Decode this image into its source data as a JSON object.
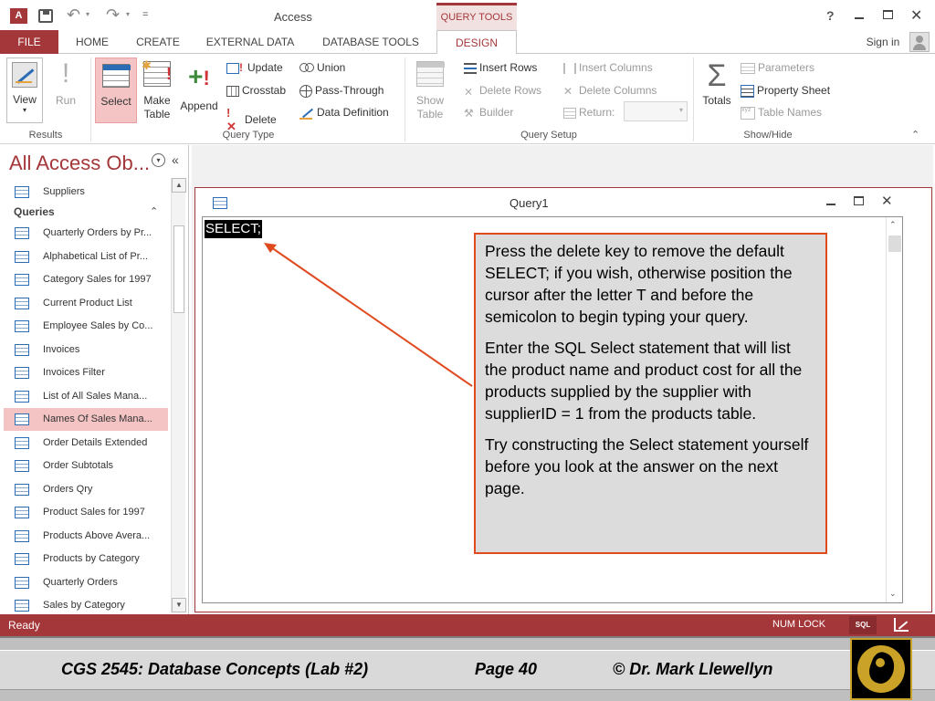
{
  "app": {
    "title": "Access",
    "help": "?",
    "context_tab_group": "QUERY TOOLS",
    "sign_in": "Sign in",
    "app_icon": "access-logo"
  },
  "quick_access": {
    "save_icon": "save-icon",
    "undo_icon": "undo-icon",
    "redo_icon": "redo-icon",
    "customize": "="
  },
  "tabs": [
    {
      "label": "FILE"
    },
    {
      "label": "HOME"
    },
    {
      "label": "CREATE"
    },
    {
      "label": "EXTERNAL DATA"
    },
    {
      "label": "DATABASE TOOLS"
    },
    {
      "label": "DESIGN"
    }
  ],
  "ribbon": {
    "results": {
      "view": "View",
      "run": "Run",
      "label": "Results"
    },
    "query_type": {
      "select": "Select",
      "make_table_1": "Make",
      "make_table_2": "Table",
      "append": "Append",
      "update": "Update",
      "crosstab": "Crosstab",
      "delete": "Delete",
      "union": "Union",
      "pass_through": "Pass-Through",
      "data_definition": "Data Definition",
      "label": "Query Type"
    },
    "query_setup": {
      "show_table_1": "Show",
      "show_table_2": "Table",
      "insert_rows": "Insert Rows",
      "delete_rows": "Delete Rows",
      "builder": "Builder",
      "insert_columns": "Insert Columns",
      "delete_columns": "Delete Columns",
      "return": "Return:",
      "label": "Query Setup"
    },
    "show_hide": {
      "totals": "Totals",
      "parameters": "Parameters",
      "property_sheet": "Property Sheet",
      "table_names": "Table Names",
      "label": "Show/Hide"
    }
  },
  "nav": {
    "title": "All Access Ob...",
    "top_item": "Suppliers",
    "section": "Queries",
    "items": [
      {
        "label": "Quarterly Orders by Pr..."
      },
      {
        "label": "Alphabetical List of Pr..."
      },
      {
        "label": "Category Sales for 1997"
      },
      {
        "label": "Current Product List"
      },
      {
        "label": "Employee Sales by Co..."
      },
      {
        "label": "Invoices"
      },
      {
        "label": "Invoices Filter"
      },
      {
        "label": "List of All Sales Mana..."
      },
      {
        "label": "Names Of Sales Mana..."
      },
      {
        "label": "Order Details Extended"
      },
      {
        "label": "Order Subtotals"
      },
      {
        "label": "Orders Qry"
      },
      {
        "label": "Product Sales for 1997"
      },
      {
        "label": "Products Above Avera..."
      },
      {
        "label": "Products by Category"
      },
      {
        "label": "Quarterly Orders"
      },
      {
        "label": "Sales by Category"
      }
    ]
  },
  "query_window": {
    "title": "Query1",
    "sql": "SELECT;"
  },
  "callout": {
    "p1": "Press the delete key to remove the default SELECT; if you wish, otherwise position the cursor after the letter T and before the semicolon to begin typing your query.",
    "p2": "Enter the SQL Select statement that will list the product name and product cost for all the products supplied by the supplier with supplierID = 1 from the products table.",
    "p3": "Try constructing the Select statement yourself before you look at the answer on the next page."
  },
  "status": {
    "ready": "Ready",
    "num_lock": "NUM LOCK",
    "sql_view": "SQL"
  },
  "footer": {
    "course": "CGS 2545: Database Concepts  (Lab #2)",
    "page": "Page 40",
    "author": "© Dr. Mark Llewellyn"
  },
  "colors": {
    "access_accent": "#a4373a",
    "callout_border": "#e04a1f",
    "selected_item": "#f4c4c5"
  }
}
